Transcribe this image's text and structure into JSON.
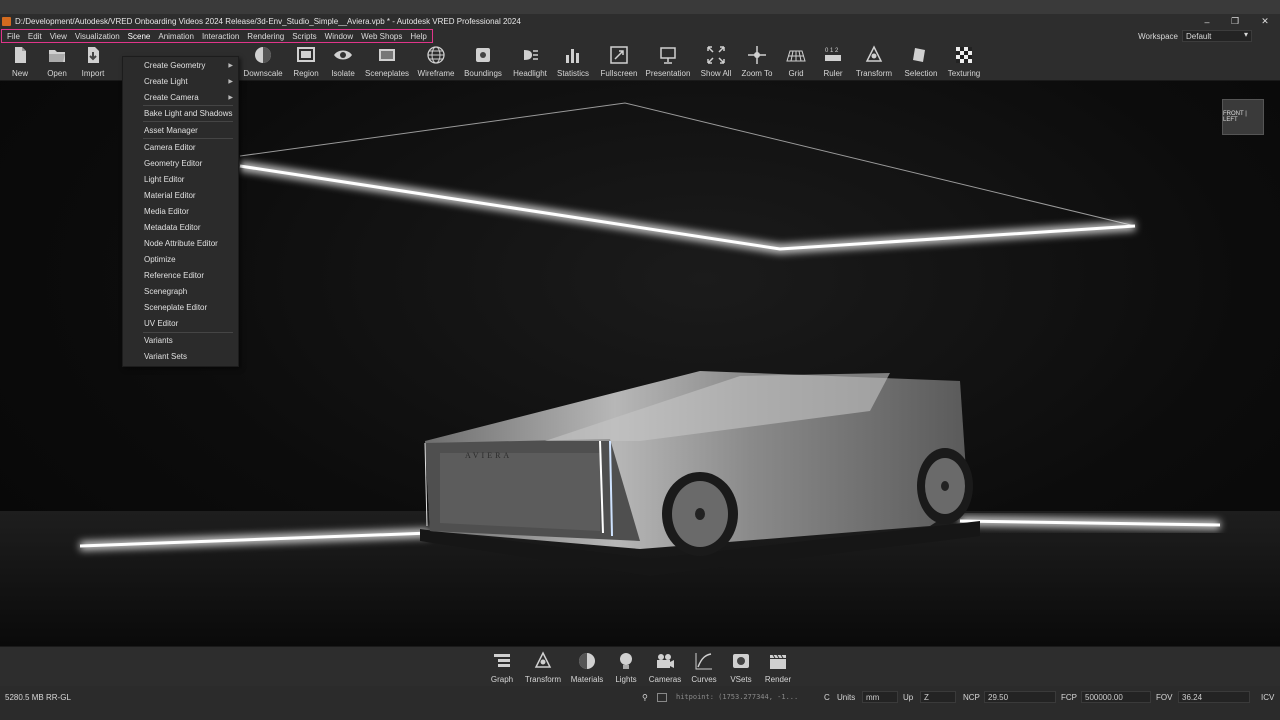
{
  "window": {
    "title": "D:/Development/Autodesk/VRED Onboarding Videos 2024 Release/3d-Env_Studio_Simple__Aviera.vpb * - Autodesk VRED Professional 2024",
    "controls": [
      "–",
      "❐",
      "✕"
    ]
  },
  "menubar": {
    "items": [
      "File",
      "Edit",
      "View",
      "Visualization",
      "Scene",
      "Animation",
      "Interaction",
      "Rendering",
      "Scripts",
      "Window",
      "Web Shops",
      "Help"
    ],
    "active": "Scene",
    "workspace_label": "Workspace",
    "workspace_value": "Default"
  },
  "toolbar": {
    "items": [
      {
        "label": "New",
        "icon": "new-file-icon"
      },
      {
        "label": "Open",
        "icon": "folder-open-icon"
      },
      {
        "label": "Import",
        "icon": "import-icon"
      },
      {
        "label": "Downscale",
        "icon": "downscale-icon"
      },
      {
        "label": "Region",
        "icon": "region-icon"
      },
      {
        "label": "Isolate",
        "icon": "eye-icon"
      },
      {
        "label": "Sceneplates",
        "icon": "sceneplate-icon"
      },
      {
        "label": "Wireframe",
        "icon": "wireframe-globe-icon"
      },
      {
        "label": "Boundings",
        "icon": "boundings-icon"
      },
      {
        "label": "Headlight",
        "icon": "headlight-icon"
      },
      {
        "label": "Statistics",
        "icon": "bar-chart-icon"
      },
      {
        "label": "Fullscreen",
        "icon": "fullscreen-icon"
      },
      {
        "label": "Presentation",
        "icon": "presentation-icon"
      },
      {
        "label": "Show All",
        "icon": "show-all-icon"
      },
      {
        "label": "Zoom To",
        "icon": "zoom-to-icon"
      },
      {
        "label": "Grid",
        "icon": "grid-icon"
      },
      {
        "label": "Ruler",
        "icon": "ruler-icon"
      },
      {
        "label": "Transform",
        "icon": "transform-icon"
      },
      {
        "label": "Selection",
        "icon": "selection-icon"
      },
      {
        "label": "Texturing",
        "icon": "checker-icon"
      }
    ]
  },
  "scene_menu": {
    "items": [
      {
        "label": "Create Geometry",
        "submenu": true
      },
      {
        "label": "Create Light",
        "submenu": true
      },
      {
        "label": "Create Camera",
        "submenu": true
      },
      {
        "label": "Bake Light and Shadows",
        "submenu": false
      },
      {
        "label": "Asset Manager",
        "submenu": false
      },
      {
        "label": "Camera Editor",
        "submenu": false
      },
      {
        "label": "Geometry Editor",
        "submenu": false
      },
      {
        "label": "Light Editor",
        "submenu": false
      },
      {
        "label": "Material Editor",
        "submenu": false
      },
      {
        "label": "Media Editor",
        "submenu": false
      },
      {
        "label": "Metadata Editor",
        "submenu": false
      },
      {
        "label": "Node Attribute Editor",
        "submenu": false
      },
      {
        "label": "Optimize",
        "submenu": false
      },
      {
        "label": "Reference Editor",
        "submenu": false
      },
      {
        "label": "Scenegraph",
        "submenu": false
      },
      {
        "label": "Sceneplate Editor",
        "submenu": false
      },
      {
        "label": "UV Editor",
        "submenu": false
      },
      {
        "label": "Variants",
        "submenu": false
      },
      {
        "label": "Variant Sets",
        "submenu": false
      }
    ]
  },
  "viewport": {
    "navcube_label": "FRONT | LEFT",
    "car_badge": "AVIERA"
  },
  "bottom_toolbar": {
    "items": [
      {
        "label": "Graph",
        "icon": "graph-icon"
      },
      {
        "label": "Transform",
        "icon": "transform-icon"
      },
      {
        "label": "Materials",
        "icon": "material-ball-icon"
      },
      {
        "label": "Lights",
        "icon": "lightbulb-icon"
      },
      {
        "label": "Cameras",
        "icon": "camera-icon"
      },
      {
        "label": "Curves",
        "icon": "curves-icon"
      },
      {
        "label": "VSets",
        "icon": "vsets-icon"
      },
      {
        "label": "Render",
        "icon": "clapperboard-icon"
      }
    ]
  },
  "statusbar": {
    "memory": "5280.5 MB",
    "renderer": "RR-GL",
    "hitpoint": "hitpoint: (1753.277344, -1...",
    "units_label": "Units",
    "units_value": "mm",
    "up_label": "Up",
    "up_value": "Z",
    "ncp_label": "NCP",
    "ncp_value": "29.50",
    "fcp_label": "FCP",
    "fcp_value": "500000.00",
    "fov_label": "FOV",
    "fov_value": "36.24",
    "icv_label": "ICV"
  },
  "colors": {
    "highlight_border": "#e0358a",
    "app_icon": "#d36b1f"
  }
}
